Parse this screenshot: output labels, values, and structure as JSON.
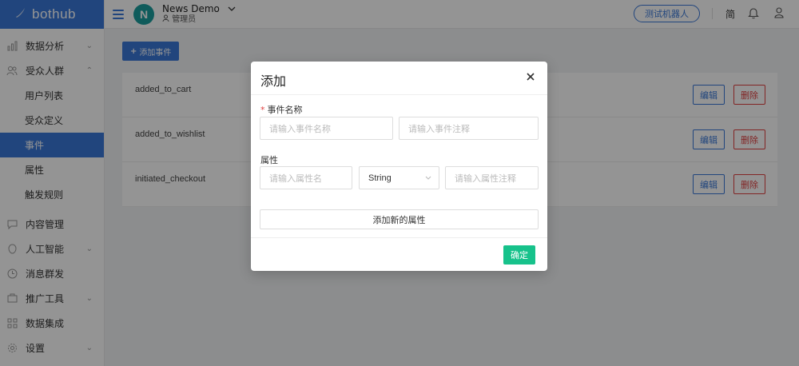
{
  "sidebar": {
    "logo_text": "bothub",
    "items": [
      {
        "label": "数据分析",
        "icon": "chart-icon",
        "has_chevron": true
      },
      {
        "label": "受众人群",
        "icon": "users-icon",
        "has_chevron": true,
        "expanded": true
      },
      {
        "label": "内容管理",
        "icon": "chat-icon",
        "has_chevron": false
      },
      {
        "label": "人工智能",
        "icon": "ai-icon",
        "has_chevron": true
      },
      {
        "label": "消息群发",
        "icon": "clock-icon",
        "has_chevron": false
      },
      {
        "label": "推广工具",
        "icon": "megaphone-icon",
        "has_chevron": true
      },
      {
        "label": "数据集成",
        "icon": "grid-icon",
        "has_chevron": false
      },
      {
        "label": "设置",
        "icon": "gear-icon",
        "has_chevron": true
      }
    ],
    "sub_items": [
      {
        "label": "用户列表",
        "active": false
      },
      {
        "label": "受众定义",
        "active": false
      },
      {
        "label": "事件",
        "active": true
      },
      {
        "label": "属性",
        "active": false
      },
      {
        "label": "触发规则",
        "active": false
      }
    ]
  },
  "header": {
    "avatar_letter": "N",
    "app_name": "News Demo",
    "role": "管理员",
    "robot_button": "测试机器人",
    "lang": "简"
  },
  "main": {
    "add_event_button": "添加事件",
    "events": [
      {
        "name": "added_to_cart",
        "edit": "编辑",
        "delete": "删除"
      },
      {
        "name": "added_to_wishlist",
        "edit": "编辑",
        "delete": "删除"
      },
      {
        "name": "initiated_checkout",
        "edit": "编辑",
        "delete": "删除"
      }
    ]
  },
  "modal": {
    "title": "添加",
    "event_name_label": "事件名称",
    "event_name_placeholder": "请输入事件名称",
    "event_note_placeholder": "请输入事件注释",
    "attr_label": "属性",
    "attr_name_placeholder": "请输入属性名",
    "attr_type_value": "String",
    "attr_note_placeholder": "请输入属性注释",
    "add_attr_button": "添加新的属性",
    "confirm_button": "确定"
  },
  "colors": {
    "primary": "#3a78d8",
    "danger": "#e04040",
    "confirm": "#17c28b",
    "avatar": "#1a9e9e"
  }
}
